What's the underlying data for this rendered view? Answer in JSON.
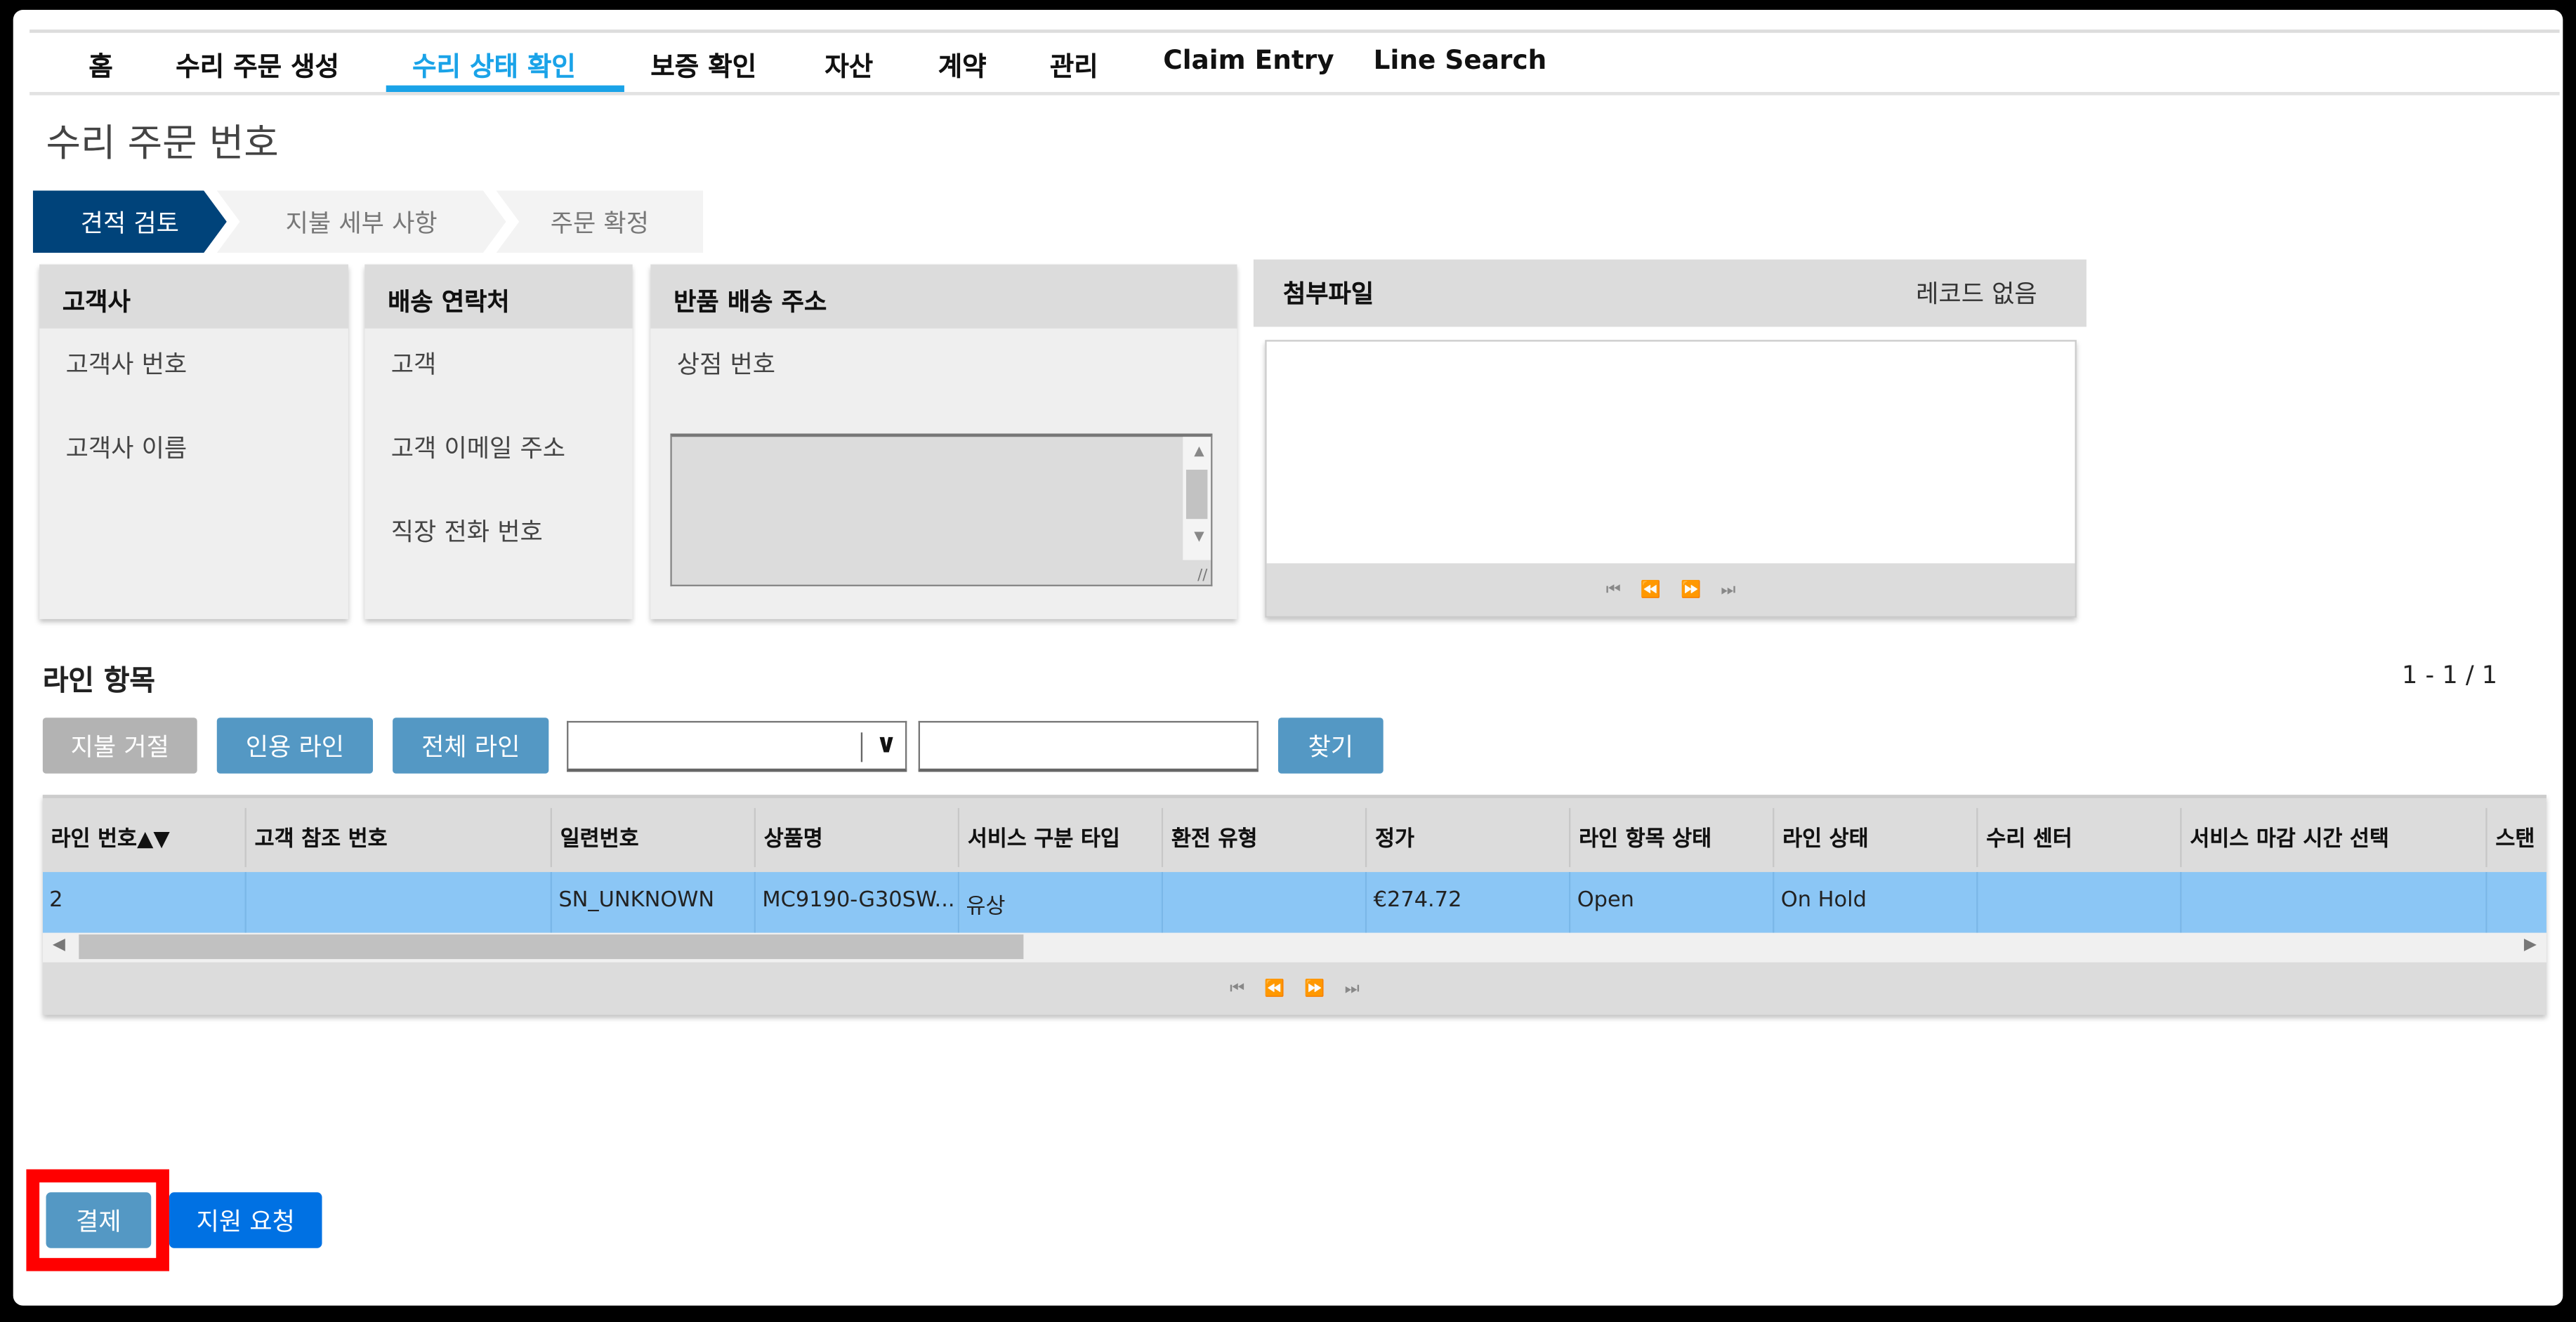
{
  "nav": {
    "items": [
      {
        "label": "홈"
      },
      {
        "label": "수리 주문 생성"
      },
      {
        "label": "수리 상태 확인",
        "active": true
      },
      {
        "label": "보증 확인"
      },
      {
        "label": "자산"
      },
      {
        "label": "계약"
      },
      {
        "label": "관리"
      },
      {
        "label": "Claim Entry"
      },
      {
        "label": "Line Search"
      }
    ],
    "accent_color": "#1aa3e8"
  },
  "page_title": "수리 주문 번호",
  "steps": [
    {
      "label": "견적 검토",
      "active": true
    },
    {
      "label": "지불 세부 사항"
    },
    {
      "label": "주문 확정"
    }
  ],
  "cards": {
    "customer": {
      "title": "고객사",
      "fields": [
        "고객사 번호",
        "고객사 이름"
      ]
    },
    "shipping_contact": {
      "title": "배송 연락처",
      "fields": [
        "고객",
        "고객 이메일 주소",
        "직장 전화 번호"
      ]
    },
    "return_address": {
      "title": "반품 배송 주소",
      "fields": [
        "상점 번호"
      ],
      "textarea_value": ""
    }
  },
  "attachments": {
    "title": "첨부파일",
    "status": "레코드 없음"
  },
  "pager_icons": {
    "first": "first-page-icon",
    "prev": "prev-page-icon",
    "next": "next-page-icon",
    "last": "last-page-icon"
  },
  "line_items": {
    "title": "라인 항목",
    "count": "1 - 1 / 1",
    "buttons": {
      "reject": "지불 거절",
      "quote": "인용 라인",
      "all": "전체 라인",
      "find": "찾기"
    },
    "filter_select_value": "",
    "filter_input_value": "",
    "columns": [
      "라인 번호▲▼",
      "고객 참조 번호",
      "일련번호",
      "상품명",
      "서비스 구분 타입",
      "환전 유형",
      "정가",
      "라인 항목 상태",
      "라인 상태",
      "수리 센터",
      "서비스 마감 시간 선택",
      "스탠"
    ],
    "rows": [
      [
        "2",
        "",
        "SN_UNKNOWN",
        "MC9190-G30SW...",
        "유상",
        "",
        "€274.72",
        "Open",
        "On Hold",
        "",
        "",
        ""
      ]
    ],
    "selected_row_color": "#8bc6f5"
  },
  "footer": {
    "pay": "결제",
    "support": "지원 요청"
  }
}
